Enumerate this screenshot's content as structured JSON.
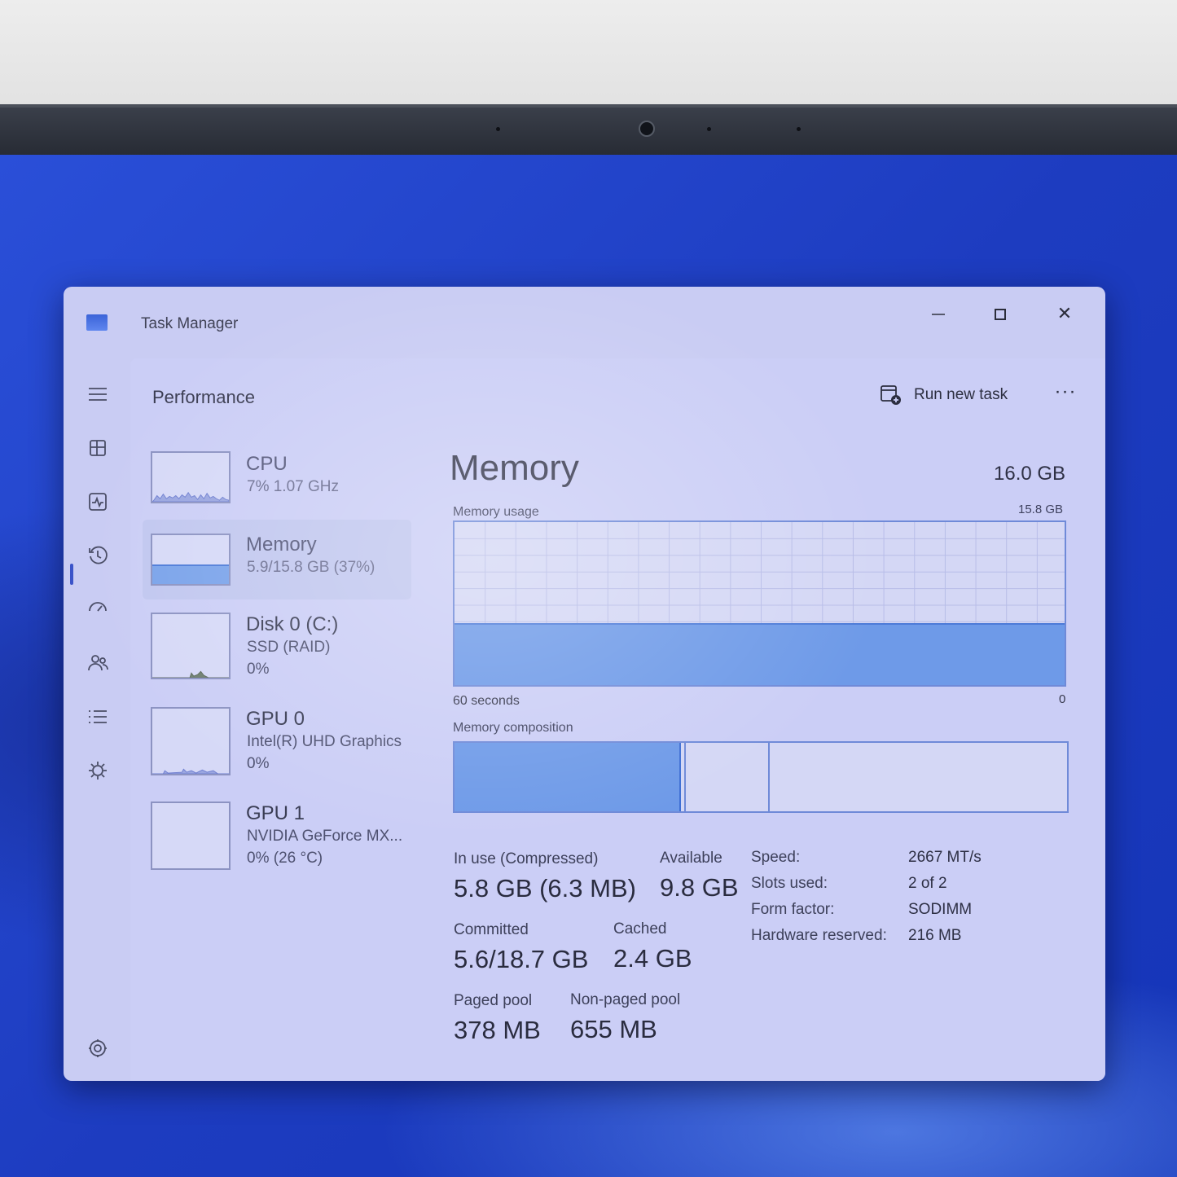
{
  "window": {
    "title": "Task Manager",
    "buttons": {
      "minimize": "minimize",
      "maximize": "maximize",
      "close": "✕"
    }
  },
  "nav": {
    "icons": [
      "hamburger-icon",
      "processes-icon",
      "performance-icon",
      "app-history-icon",
      "startup-apps-icon",
      "users-icon",
      "details-icon",
      "services-icon",
      "settings-icon"
    ],
    "selected": "performance"
  },
  "header": {
    "page_title": "Performance",
    "run_task_label": "Run new task",
    "more_label": "···"
  },
  "perf_list": [
    {
      "name": "CPU",
      "sub1": "7%  1.07 GHz",
      "sub2": ""
    },
    {
      "name": "Memory",
      "sub1": "5.9/15.8 GB (37%)",
      "sub2": "",
      "selected": true
    },
    {
      "name": "Disk 0 (C:)",
      "sub1": "SSD (RAID)",
      "sub2": "0%"
    },
    {
      "name": "GPU 0",
      "sub1": "Intel(R) UHD Graphics",
      "sub2": "0%"
    },
    {
      "name": "GPU 1",
      "sub1": "NVIDIA GeForce MX...",
      "sub2": "0%  (26 °C)"
    }
  ],
  "memory": {
    "title": "Memory",
    "total": "16.0 GB",
    "usage_label": "Memory usage",
    "usage_max": "15.8 GB",
    "usage_fraction": 0.37,
    "x_left": "60 seconds",
    "x_right": "0",
    "composition_label": "Memory composition",
    "composition_inuse_fraction": 0.37,
    "composition_modified_fraction": 0.14,
    "stats": {
      "in_use_label": "In use (Compressed)",
      "in_use_value": "5.8 GB (6.3 MB)",
      "available_label": "Available",
      "available_value": "9.8 GB",
      "committed_label": "Committed",
      "committed_value": "5.6/18.7 GB",
      "cached_label": "Cached",
      "cached_value": "2.4 GB",
      "paged_label": "Paged pool",
      "paged_value": "378 MB",
      "nonpaged_label": "Non-paged pool",
      "nonpaged_value": "655 MB"
    },
    "specs": [
      {
        "key": "Speed:",
        "value": "2667 MT/s"
      },
      {
        "key": "Slots used:",
        "value": "2 of 2"
      },
      {
        "key": "Form factor:",
        "value": "SODIMM"
      },
      {
        "key": "Hardware reserved:",
        "value": "216 MB"
      }
    ]
  },
  "colors": {
    "accent": "#3b54c9",
    "graph_fill": "#6e9ae8",
    "graph_border": "#6f8ad8",
    "window_bg": "#c9ccf3"
  }
}
